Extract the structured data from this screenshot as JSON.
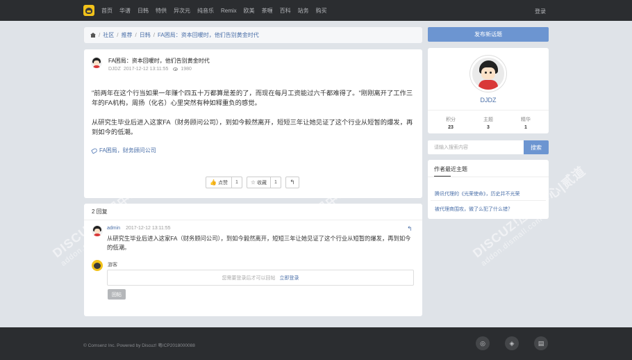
{
  "nav": {
    "items": [
      "首页",
      "华谱",
      "日韩",
      "特供",
      "异次元",
      "纯音乐",
      "Remix",
      "欧美",
      "茶喱",
      "百科",
      "站务",
      "购买"
    ],
    "login": "登录"
  },
  "breadcrumb": [
    "社区",
    "推荐",
    "日韩",
    "FA困局：资本回暖时，他们告别黄金时代"
  ],
  "post": {
    "title": "FA困局：资本回暖时，他们告别黄金时代",
    "author": "DJDZ",
    "time": "2017-12-12 13:11:55",
    "views": "1980",
    "paragraph1": "\"前两年在这个行当如果一年赚个四五十万都算是差的了，而现在每月工资能过六千都难得了。\"刚刚离开了工作三年的FA机构，周扬（化名）心里突然有种如释重负的感觉。",
    "paragraph2": "从研究生毕业后进入这家FA（财务顾问公司），到如今毅然离开，短短三年让她见证了这个行业从短暂的爆发，再到如今的低潮。",
    "tags": "FA困局，财务顾问公司",
    "like_label": "点赞",
    "like_count": "1",
    "fav_label": "收藏",
    "fav_count": "1"
  },
  "replies": {
    "header": "2 回复",
    "items": [
      {
        "user": "admin",
        "time": "2017-12-12 13:11:55",
        "text": "从研究生毕业后进入这家FA（财务顾问公司），到如今毅然离开，短短三年让她见证了这个行业从短暂的爆发，再到如今的低潮。"
      }
    ],
    "guest_label": "游客",
    "login_prompt": "您需要登录后才可以回帖",
    "login_link": "立即登录",
    "reply_button": "回帖"
  },
  "sidebar": {
    "new_topic": "发布新话题",
    "profile_name": "DJDZ",
    "stats": [
      {
        "label": "积分",
        "value": "23"
      },
      {
        "label": "主题",
        "value": "3"
      },
      {
        "label": "精华",
        "value": "1"
      }
    ],
    "search_placeholder": "请输入搜索内容",
    "search_button": "搜索",
    "recent_title": "作者最近主题",
    "recent_items": [
      "腾讯代理的《光荣使命》，历史并不光荣",
      "被代理商围攻，微了么犯了什么错？"
    ]
  },
  "footer": {
    "copyright": "© Comsenz Inc. Powered by Discuz! 粤ICP2018000088"
  },
  "watermark": {
    "line1": "DISCUZ!应用中心|贰道",
    "line2": "addon.dismall.com"
  },
  "colors": {
    "accent": "#6c95d1",
    "link": "#4a6fa8",
    "nav_bg": "#2b2d30",
    "page_bg": "#dfe3e8"
  }
}
